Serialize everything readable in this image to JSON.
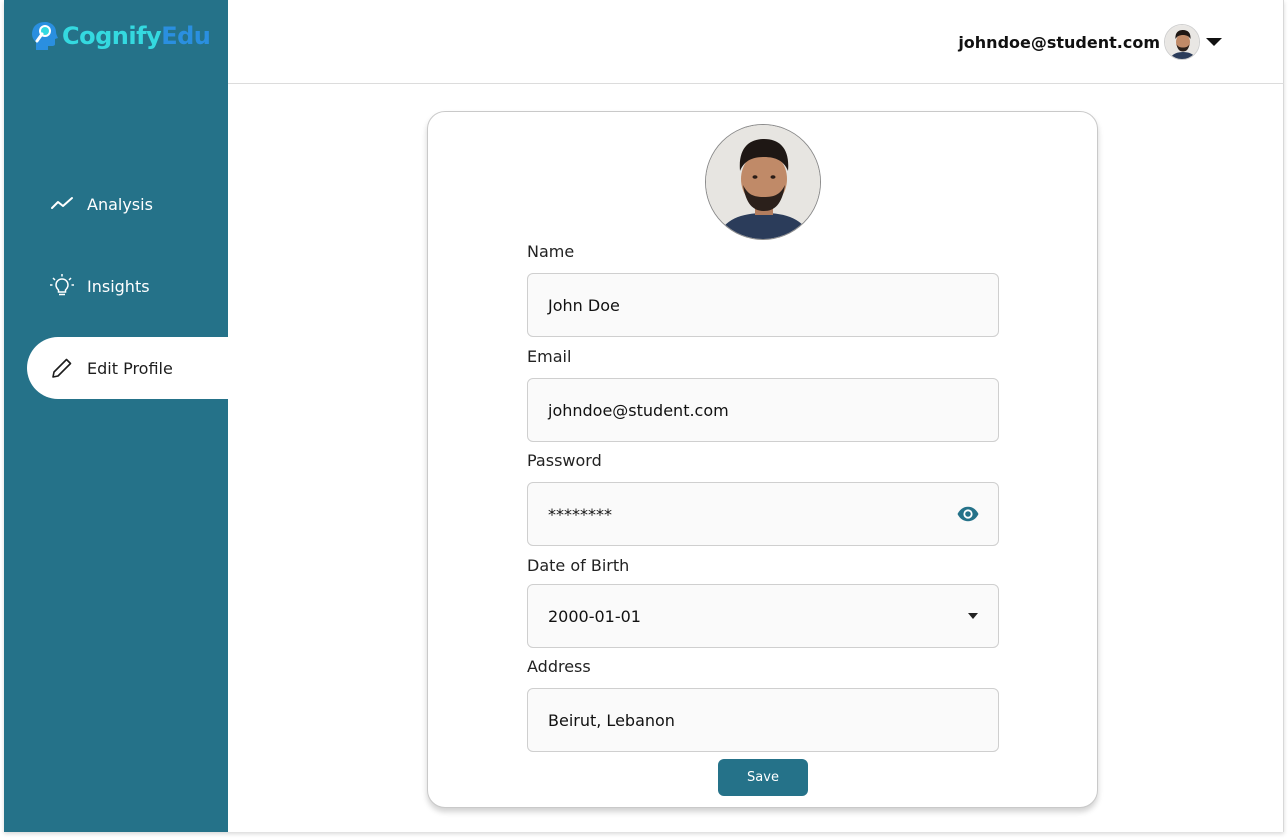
{
  "brand": {
    "name_part1": "Cognify",
    "name_part2": "Edu",
    "color1": "#34d9e0",
    "color2": "#2a8fe0"
  },
  "colors": {
    "sidebar": "#257289",
    "accent": "#257289"
  },
  "sidebar": {
    "items": [
      {
        "label": "Analysis",
        "icon": "trend-line-icon",
        "active": false
      },
      {
        "label": "Insights",
        "icon": "lightbulb-icon",
        "active": false
      },
      {
        "label": "Edit Profile",
        "icon": "pencil-icon",
        "active": true
      }
    ]
  },
  "header": {
    "user_email": "johndoe@student.com",
    "avatar": "user-avatar",
    "menu_icon": "caret-down-icon"
  },
  "form": {
    "name_label": "Name",
    "name_value": "John Doe",
    "email_label": "Email",
    "email_value": "johndoe@student.com",
    "password_label": "Password",
    "password_value": "********",
    "password_icon": "eye-icon",
    "dob_label": "Date of Birth",
    "dob_value": "2000-01-01",
    "dob_icon": "caret-down-icon",
    "address_label": "Address",
    "address_value": "Beirut, Lebanon",
    "save_label": "Save"
  }
}
